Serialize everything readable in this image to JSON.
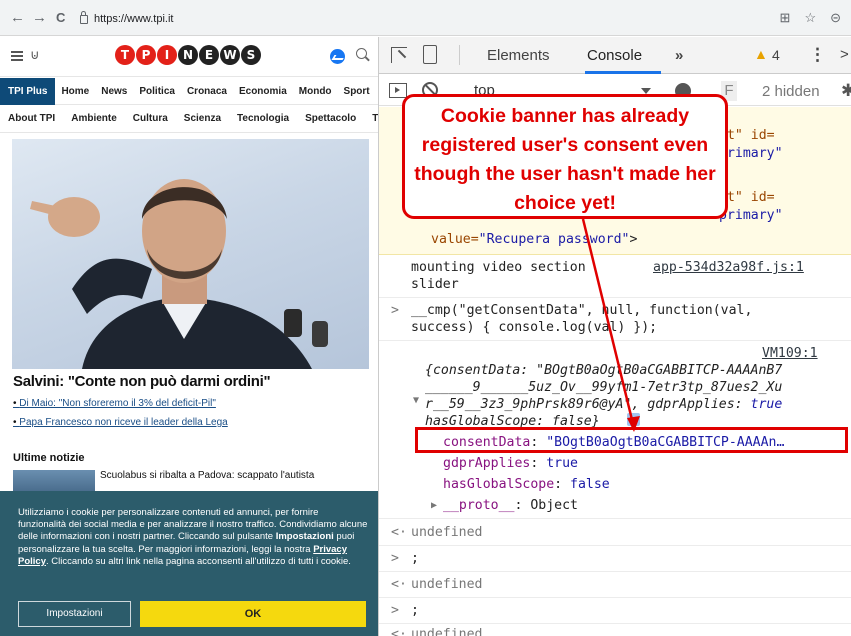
{
  "browser": {
    "back_icon": "←",
    "forward_icon": "→",
    "reload_icon": "C",
    "url": "https://www.tpi.it",
    "translate_icon": "⊞",
    "star_icon": "☆",
    "profile_icon": "⊝"
  },
  "site": {
    "logo_letters": [
      "T",
      "P",
      "I",
      "N",
      "E",
      "W",
      "S"
    ],
    "menu_primary": [
      "TPI Plus",
      "Home",
      "News",
      "Politica",
      "Cronaca",
      "Economia",
      "Mondo",
      "Sport",
      "F"
    ],
    "menu_secondary": [
      "About TPI",
      "Ambiente",
      "Cultura",
      "Scienza",
      "Tecnologia",
      "Spettacolo",
      "TV"
    ],
    "headline": "Salvini: \"Conte non può darmi ordini\"",
    "sublinks": [
      "Di Maio: \"Non sforeremo il 3% del deficit-Pil\"",
      "Papa Francesco non riceve il leader della Lega"
    ],
    "ultime_notizie": "Ultime notizie",
    "news_item": "Scuolabus si ribalta a Padova: scappato l'autista",
    "cookie": {
      "text_1": "Utilizziamo i cookie per personalizzare contenuti ed annunci, per fornire funzionalità dei social media e per analizzare il nostro traffico. Condividiamo alcune delle informazioni con i nostri partner. Cliccando sul pulsante ",
      "bold_1": "Impostazioni",
      "text_2": " puoi personalizzare la tua scelta. Per maggiori informazioni, leggi la nostra ",
      "link": "Privacy Policy",
      "text_3": ". Cliccando su altri link nella pagina acconsenti all'utilizzo di tutti i cookie.",
      "settings_button": "Impostazioni",
      "ok_button": "OK"
    }
  },
  "devtools": {
    "tabs": [
      "Elements",
      "Console"
    ],
    "more_tabs": "»",
    "warning_count": "4",
    "context": "top",
    "filter_placeholder": "F",
    "hidden_count": "2 hidden",
    "warn_lines": [
      "it\" id=",
      "primary\"",
      "it\" id=",
      "primary\""
    ],
    "warn_line_5a": "value=",
    "warn_line_5b": "\"Recupera password\"",
    "warn_line_5c": ">",
    "log_mounting": "mounting video section",
    "log_mounting_2": "slider",
    "log_mounting_src": "app-534d32a98f.js:1",
    "cmd_1": "__cmp(\"getConsentData\", null, function(val,",
    "cmd_2": "success) { console.log(val) });",
    "vm_src": "VM109:1",
    "obj_line_1": "{consentData: \"BOgtB0aOgtB0aCGABBITCP-AAAAnB7",
    "obj_line_2": "______9______5uz_Ov__99yfm1-7etr3tp_87ues2_Xu",
    "obj_line_3a": "r__59__3z3_9phPrsk89r6@yA\"",
    "obj_line_3b": ", gdprApplies: ",
    "obj_line_3c": "true",
    "obj_line_4": "hasGlobalScope: false}",
    "prop_consent_key": "consentData",
    "prop_consent_val": "\"BOgtB0aOgtB0aCGABBITCP-AAAAn…",
    "prop_gdpr_key": "gdprApplies",
    "prop_gdpr_val": "true",
    "prop_global_key": "hasGlobalScope",
    "prop_global_val": "false",
    "prop_proto_key": "__proto__",
    "prop_proto_val": "Object",
    "undefined": "undefined",
    "semicolon": ";"
  },
  "annotation": {
    "callout": "Cookie banner has already registered user's consent even though the user hasn't made her choice yet!",
    "color": "#e00000"
  }
}
